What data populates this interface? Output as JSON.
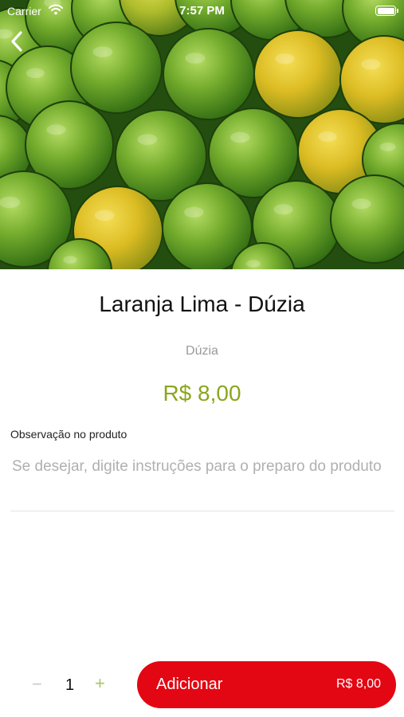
{
  "status_bar": {
    "carrier": "Carrier",
    "time": "7:57 PM"
  },
  "hero": {
    "image_subject": "stacked green and yellow limes",
    "icon_back": "chevron-left-icon"
  },
  "product": {
    "title": "Laranja Lima - Dúzia",
    "unit": "Dúzia",
    "price": "R$ 8,00"
  },
  "observation": {
    "label": "Observação no produto",
    "placeholder": "Se desejar, digite instruções para o preparo do produto",
    "value": ""
  },
  "quantity": {
    "minus": "−",
    "value": "1",
    "plus": "+"
  },
  "add_button": {
    "label": "Adicionar",
    "price": "R$ 8,00"
  },
  "colors": {
    "accent_red": "#e30613",
    "price_green": "#8aa61c",
    "lime_green": "#6fa52a",
    "lime_yellow": "#e3c21e"
  }
}
